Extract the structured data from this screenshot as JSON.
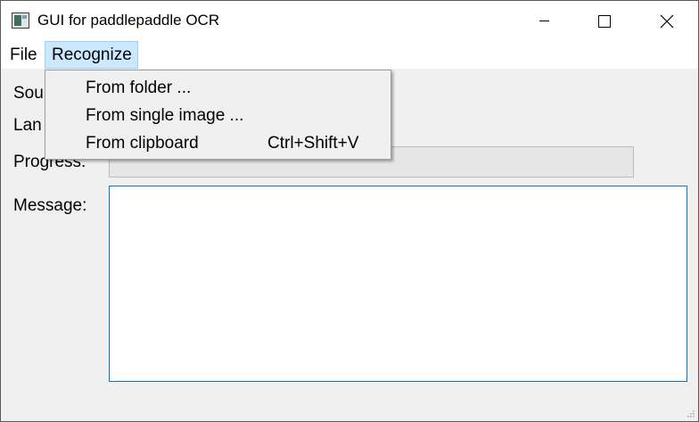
{
  "window": {
    "title": "GUI for paddlepaddle OCR",
    "app_icon": "app-window-icon"
  },
  "menubar": {
    "file_label": "File",
    "recognize_label": "Recognize"
  },
  "recognize_menu": {
    "items": [
      {
        "label": "From folder ...",
        "shortcut": ""
      },
      {
        "label": "From single image ...",
        "shortcut": ""
      },
      {
        "label": "From clipboard",
        "shortcut": "Ctrl+Shift+V"
      }
    ]
  },
  "form": {
    "source_label": "Sou",
    "language_label": "Lan",
    "progress_label": "Progress:",
    "progress_value": 0,
    "message_label": "Message:",
    "message_value": ""
  },
  "colors": {
    "menu_highlight": "#cce8ff",
    "message_border": "#0078d7",
    "progress_fill": "#06b025"
  }
}
